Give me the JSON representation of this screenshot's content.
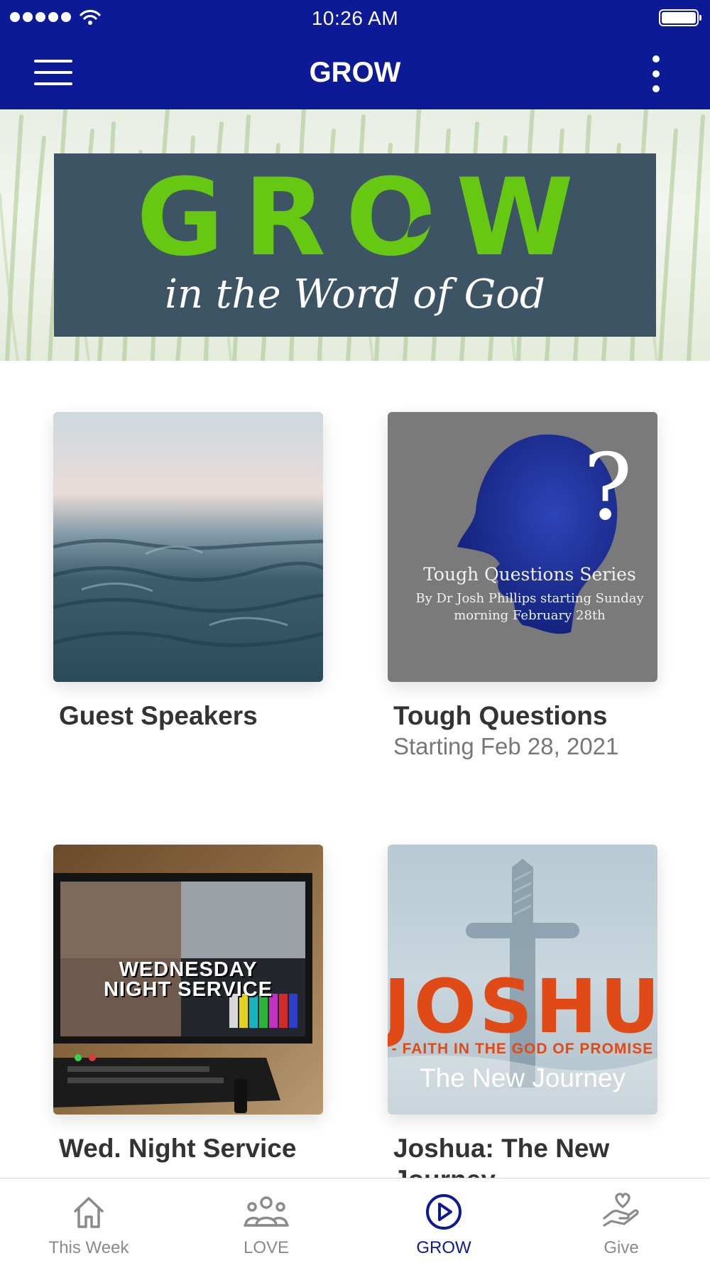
{
  "status_bar": {
    "time": "10:26 AM"
  },
  "nav": {
    "title": "GROW",
    "menu_icon": "hamburger-menu-icon",
    "more_icon": "vertical-dots-icon"
  },
  "banner": {
    "logo_text": "GROW",
    "tagline": "in the Word of God"
  },
  "cards": [
    {
      "title": "Guest Speakers",
      "subtitle": ""
    },
    {
      "title": "Tough Questions",
      "subtitle": "Starting Feb 28, 2021",
      "image_text": {
        "question_mark": "?",
        "heading": "Tough Questions Series",
        "line1": "By Dr Josh Phillips starting Sunday",
        "line2": "morning February 28th"
      }
    },
    {
      "title": "Wed. Night Service",
      "subtitle": "",
      "image_text": {
        "line1": "WEDNESDAY",
        "line2": "NIGHT SERVICE"
      }
    },
    {
      "title": "Joshua: The New Journey",
      "subtitle": "",
      "image_text": {
        "title": "JOSHUA",
        "tagline": "- FAITH IN THE GOD OF PROMISE",
        "journey": "The New Journey"
      }
    }
  ],
  "tabs": [
    {
      "label": "This Week",
      "icon": "home-icon",
      "active": false
    },
    {
      "label": "LOVE",
      "icon": "people-group-icon",
      "active": false
    },
    {
      "label": "GROW",
      "icon": "play-circle-icon",
      "active": true
    },
    {
      "label": "Give",
      "icon": "hand-heart-icon",
      "active": false
    }
  ],
  "colors": {
    "brand_blue": "#0d1a96",
    "grow_green": "#67c811",
    "banner_slate": "#3c5463",
    "joshua_orange": "#e04a16",
    "tab_inactive": "#8a8a8a"
  }
}
